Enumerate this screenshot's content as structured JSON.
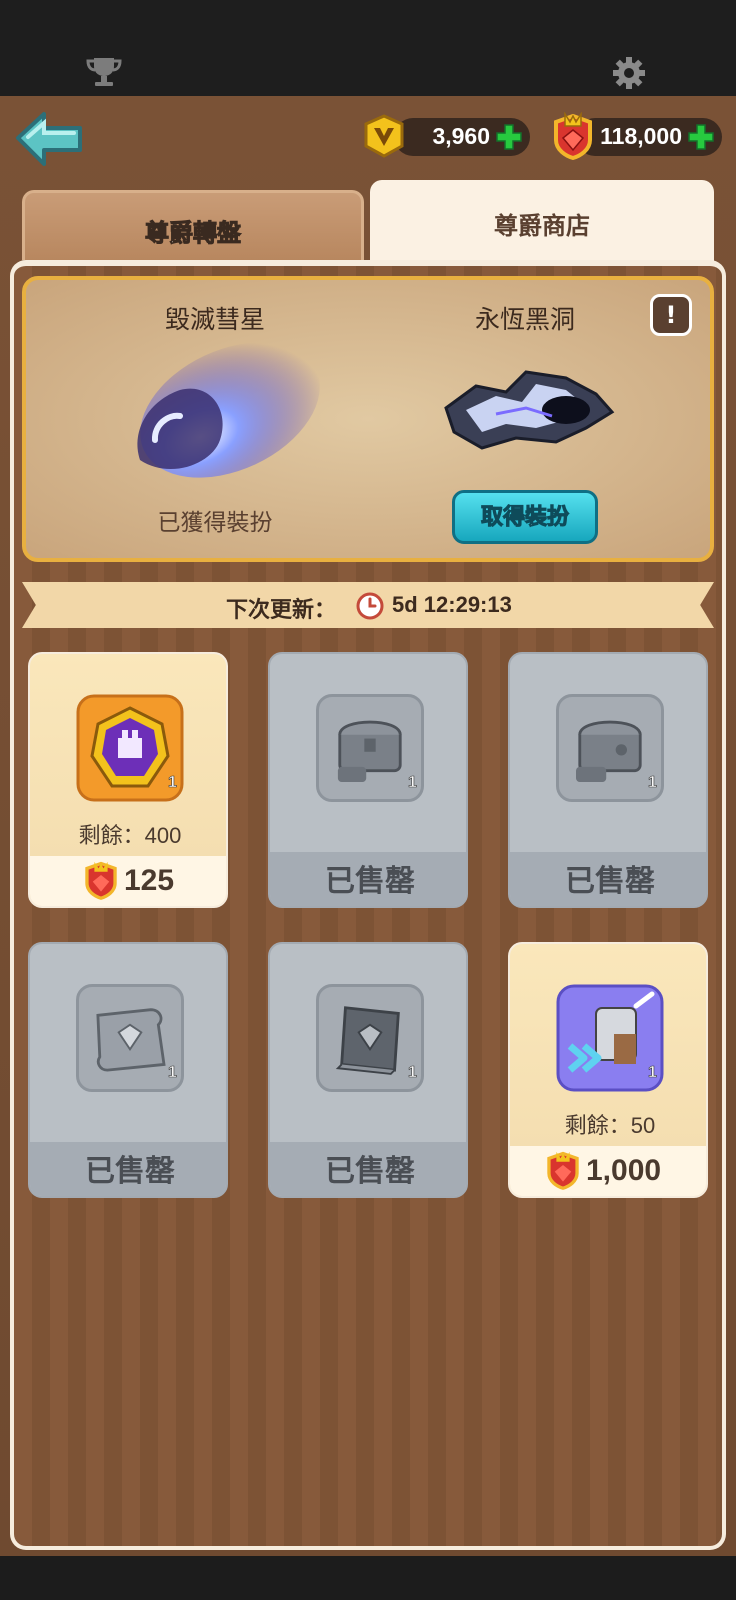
{
  "currencies": {
    "v_coins": "3,960",
    "rubies": "118,000"
  },
  "tabs": [
    {
      "label": "尊爵轉盤",
      "active": false
    },
    {
      "label": "尊爵商店",
      "active": true
    }
  ],
  "cosmetics": {
    "left_name": "毀滅彗星",
    "left_status": "已獲得裝扮",
    "right_name": "永恆黑洞",
    "right_button": "取得裝扮",
    "info_symbol": "!"
  },
  "refresh": {
    "label": "下次更新：",
    "time": "5d 12:29:13"
  },
  "shop": [
    {
      "icon": "purple-emblem-icon",
      "qty": "1",
      "remain": "剩餘：400",
      "price": "125",
      "sold": false
    },
    {
      "icon": "treasure-chest-icon",
      "qty": "1",
      "sold": true,
      "sold_label": "已售罄"
    },
    {
      "icon": "treasure-chest-icon",
      "qty": "1",
      "sold": true,
      "sold_label": "已售罄"
    },
    {
      "icon": "diamond-scroll-icon",
      "qty": "1",
      "sold": true,
      "sold_label": "已售罄"
    },
    {
      "icon": "diamond-book-icon",
      "qty": "1",
      "sold": true,
      "sold_label": "已售罄"
    },
    {
      "icon": "armor-upgrade-icon",
      "qty": "1",
      "remain": "剩餘：50",
      "price": "1,000",
      "sold": false
    }
  ],
  "colors": {
    "wood": "#7a5236",
    "panel_border": "#f6ecdd",
    "gold_border": "#e8b040",
    "button_teal": "#17a7be",
    "plus_green": "#27c93f"
  }
}
